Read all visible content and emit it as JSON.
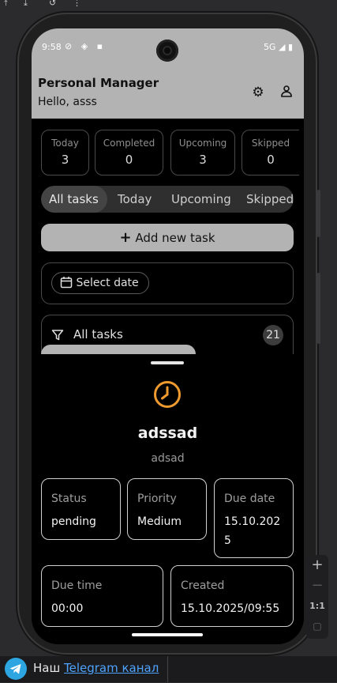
{
  "status_bar": {
    "time": "9:58",
    "network": "5G"
  },
  "app": {
    "title": "Personal Manager",
    "greeting": "Hello, asss"
  },
  "stats": [
    {
      "label": "Today",
      "value": "3"
    },
    {
      "label": "Completed",
      "value": "0"
    },
    {
      "label": "Upcoming",
      "value": "3"
    },
    {
      "label": "Skipped",
      "value": "0"
    }
  ],
  "tabs": [
    {
      "label": "All tasks",
      "selected": true
    },
    {
      "label": "Today",
      "selected": false
    },
    {
      "label": "Upcoming",
      "selected": false
    },
    {
      "label": "Skipped",
      "selected": false
    }
  ],
  "add_button": {
    "label": "Add new task",
    "icon": "plus-icon"
  },
  "date_filter": {
    "label": "Select date",
    "icon": "calendar-icon"
  },
  "list_header": {
    "label": "All tasks",
    "count": "21",
    "icon": "filter-icon"
  },
  "task_detail": {
    "icon": "clock-icon",
    "icon_color": "#ee9a2f",
    "name": "adssad",
    "description": "adsad",
    "fields": [
      {
        "label": "Status",
        "value": "pending"
      },
      {
        "label": "Priority",
        "value": "Medium"
      },
      {
        "label": "Due date",
        "value": "15.10.2025"
      },
      {
        "label": "Due time",
        "value": "00:00"
      },
      {
        "label": "Created",
        "value": "15.10.2025/09:55"
      }
    ]
  },
  "emulator_tools": {
    "zoom_label": "1:1"
  },
  "footer": {
    "prefix": "Наш",
    "link": "Telegram канал",
    "icon": "telegram-icon"
  },
  "colors": {
    "accent": "#ee9a2f",
    "appbar": "#b3b3b3",
    "link": "#4ea3ff"
  }
}
